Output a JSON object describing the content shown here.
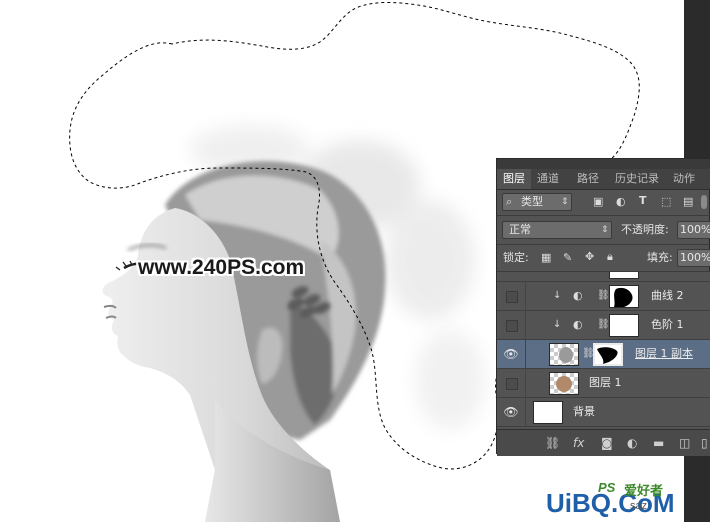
{
  "canvas": {
    "watermark": "www.240PS.com"
  },
  "logo": {
    "main": "UiBQ.CoM",
    "ps_mark": "PS",
    "cn_text": "爱好者",
    "sub": "saz"
  },
  "layers_panel": {
    "tabs": [
      {
        "label": "图层",
        "active": true
      },
      {
        "label": "通道",
        "active": false
      },
      {
        "label": "路径",
        "active": false
      },
      {
        "label": "历史记录",
        "active": false
      },
      {
        "label": "动作",
        "active": false
      }
    ],
    "filter": {
      "icon": "search-icon",
      "label": "类型"
    },
    "blend_mode": "正常",
    "opacity_label": "不透明度:",
    "opacity_value": "100%",
    "lock_label": "锁定:",
    "fill_label": "填充:",
    "fill_value": "100%",
    "layers": [
      {
        "name": "曲线 2",
        "visible": false,
        "type": "adjustment",
        "clipped": true,
        "selected": false
      },
      {
        "name": "色阶 1",
        "visible": false,
        "type": "adjustment",
        "clipped": true,
        "selected": false
      },
      {
        "name": "图层 1 副本",
        "visible": true,
        "type": "pixel-mask",
        "clipped": false,
        "selected": true
      },
      {
        "name": "图层 1",
        "visible": false,
        "type": "pixel",
        "clipped": false,
        "selected": false
      },
      {
        "name": "背景",
        "visible": true,
        "type": "background",
        "clipped": false,
        "selected": false
      }
    ],
    "bottom_icons": [
      "link-icon",
      "fx-icon",
      "mask-icon",
      "adjustment-icon",
      "folder-icon",
      "new-layer-icon",
      "trash-icon"
    ],
    "bottom_fx_label": "fx"
  },
  "colors": {
    "panel_bg": "#535353",
    "selected_row": "#5c6d86",
    "app_dark": "#2b2b2b"
  }
}
